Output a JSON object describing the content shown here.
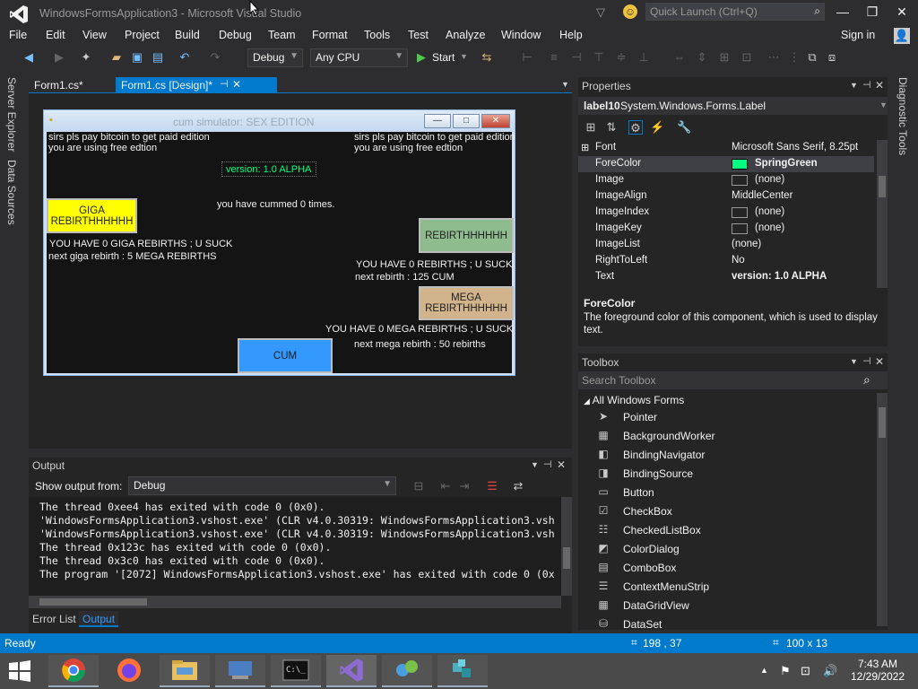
{
  "window": {
    "title": "WindowsFormsApplication3 - Microsoft Visual Studio",
    "quick_launch_placeholder": "Quick Launch (Ctrl+Q)"
  },
  "menu": [
    "File",
    "Edit",
    "View",
    "Project",
    "Build",
    "Debug",
    "Team",
    "Format",
    "Tools",
    "Test",
    "Analyze",
    "Window",
    "Help"
  ],
  "sign_in": "Sign in",
  "toolbar": {
    "config": "Debug",
    "platform": "Any CPU",
    "start_label": "Start"
  },
  "side_tabs": [
    "Server Explorer",
    "Data Sources"
  ],
  "right_side_tab": "Diagnostic Tools",
  "doc_tabs": [
    {
      "label": "Form1.cs*"
    },
    {
      "label": "Form1.cs [Design]*"
    }
  ],
  "form": {
    "title": "cum simulator: SEX EDITION",
    "pay_text": "sirs pls pay bitcoin to  get paid edition",
    "free_text": "you are using free edtion",
    "pay_text_right": "sirs pls pay bitcoin to  get paid edition",
    "free_text_right": "you are using free edtion",
    "version": "version: 1.0 ALPHA",
    "cummed": "you have cummed 0 times.",
    "giga_button": "GIGA REBIRTHHHHHH",
    "giga_status": "YOU HAVE  0 GIGA REBIRTHS ; U SUCK",
    "giga_next": "next giga rebirth : 5 MEGA REBIRTHS",
    "rebirth_button": "REBIRTHHHHHH",
    "rebirth_status": "YOU HAVE  0 REBIRTHS ; U SUCK",
    "rebirth_next": "next rebirth : 125 CUM",
    "mega_button": "MEGA REBIRTHHHHHH",
    "mega_status": "YOU HAVE  0 MEGA REBIRTHS ; U SUCK",
    "mega_next": "next mega rebirth : 50 rebirths",
    "cum_button": "CUM"
  },
  "output": {
    "title": "Output",
    "show_from_label": "Show output from:",
    "show_from_value": "Debug",
    "lines": [
      "The thread 0xee4 has exited with code 0 (0x0).",
      "'WindowsFormsApplication3.vshost.exe' (CLR v4.0.30319: WindowsFormsApplication3.vsh",
      "'WindowsFormsApplication3.vshost.exe' (CLR v4.0.30319: WindowsFormsApplication3.vsh",
      "The thread 0x123c has exited with code 0 (0x0).",
      "The thread 0x3c0 has exited with code 0 (0x0).",
      "The program '[2072] WindowsFormsApplication3.vshost.exe' has exited with code 0 (0x"
    ],
    "bottom_tabs": [
      "Error List",
      "Output"
    ]
  },
  "properties": {
    "title": "Properties",
    "object_name": "label10",
    "object_type": "System.Windows.Forms.Label",
    "rows": [
      {
        "name": "Font",
        "value": "Microsoft Sans Serif, 8.25pt"
      },
      {
        "name": "ForeColor",
        "value": "SpringGreen"
      },
      {
        "name": "Image",
        "value": "(none)"
      },
      {
        "name": "ImageAlign",
        "value": "MiddleCenter"
      },
      {
        "name": "ImageIndex",
        "value": "(none)"
      },
      {
        "name": "ImageKey",
        "value": "(none)"
      },
      {
        "name": "ImageList",
        "value": "(none)"
      },
      {
        "name": "RightToLeft",
        "value": "No"
      },
      {
        "name": "Text",
        "value": "version: 1.0 ALPHA"
      }
    ],
    "desc_title": "ForeColor",
    "desc_text": "The foreground color of this component, which is used to display text.",
    "forecolor_swatch": "#00ff7f"
  },
  "toolbox": {
    "title": "Toolbox",
    "search_placeholder": "Search Toolbox",
    "group": "All Windows Forms",
    "items": [
      "Pointer",
      "BackgroundWorker",
      "BindingNavigator",
      "BindingSource",
      "Button",
      "CheckBox",
      "CheckedListBox",
      "ColorDialog",
      "ComboBox",
      "ContextMenuStrip",
      "DataGridView",
      "DataSet"
    ]
  },
  "status": {
    "text": "Ready",
    "position": "198 , 37",
    "size": "100 x 13"
  },
  "clock": {
    "time": "7:43 AM",
    "date": "12/29/2022"
  },
  "colors": {
    "accent": "#007acc",
    "spring_green": "#00ff7f",
    "giga": "#ffff00",
    "rebirth": "#8fbc8f",
    "mega": "#d2b48c",
    "cum": "#3399ff"
  }
}
